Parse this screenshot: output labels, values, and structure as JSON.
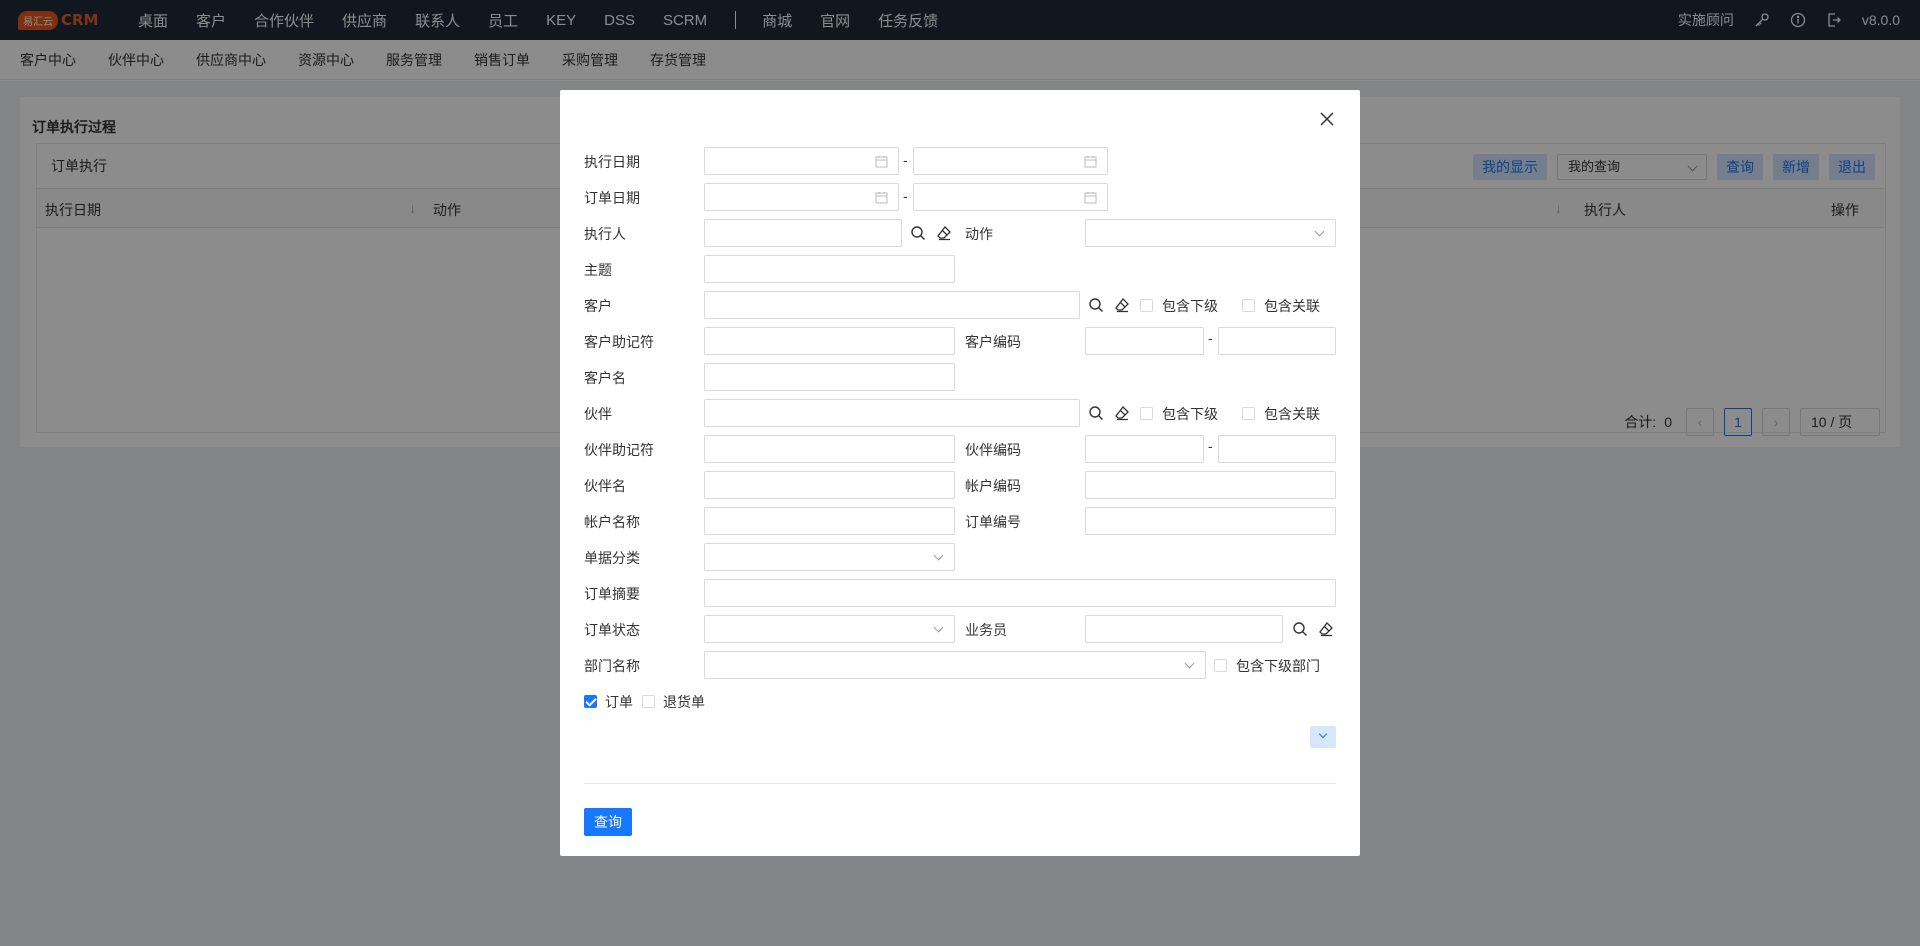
{
  "topbar": {
    "logo_badge": "易汇云",
    "logo_text": "CRM",
    "nav": [
      "桌面",
      "客户",
      "合作伙伴",
      "供应商",
      "联系人",
      "员工",
      "KEY",
      "DSS",
      "SCRM",
      "商城",
      "官网",
      "任务反馈"
    ],
    "consultant": "实施顾问",
    "version": "v8.0.0"
  },
  "subnav": [
    "客户中心",
    "伙伴中心",
    "供应商中心",
    "资源中心",
    "服务管理",
    "销售订单",
    "采购管理",
    "存货管理"
  ],
  "page": {
    "title": "订单执行过程",
    "section": "订单执行",
    "toolbar": {
      "my_display": "我的显示",
      "my_query": "我的查询",
      "query": "查询",
      "add": "新增",
      "exit": "退出"
    },
    "columns": {
      "exec_date": "执行日期",
      "action": "动作",
      "executor": "执行人",
      "operation": "操作"
    },
    "pager": {
      "total_label": "合计:",
      "total": "0",
      "current": "1",
      "size": "10 / 页"
    }
  },
  "modal": {
    "labels": {
      "exec_date": "执行日期",
      "order_date": "订单日期",
      "executor": "执行人",
      "action": "动作",
      "subject": "主题",
      "customer": "客户",
      "include_sub": "包含下级",
      "include_rel": "包含关联",
      "customer_mnemonic": "客户助记符",
      "customer_code": "客户编码",
      "customer_name": "客户名",
      "partner": "伙伴",
      "partner_mnemonic": "伙伴助记符",
      "partner_code": "伙伴编码",
      "partner_name": "伙伴名",
      "account_code": "帐户编码",
      "account_name": "帐户名称",
      "order_no": "订单编号",
      "doc_category": "单据分类",
      "order_summary": "订单摘要",
      "order_status": "订单状态",
      "salesman": "业务员",
      "dept_name": "部门名称",
      "include_sub_dept": "包含下级部门",
      "order": "订单",
      "return_order": "退货单"
    },
    "dash": "-",
    "submit": "查询"
  }
}
